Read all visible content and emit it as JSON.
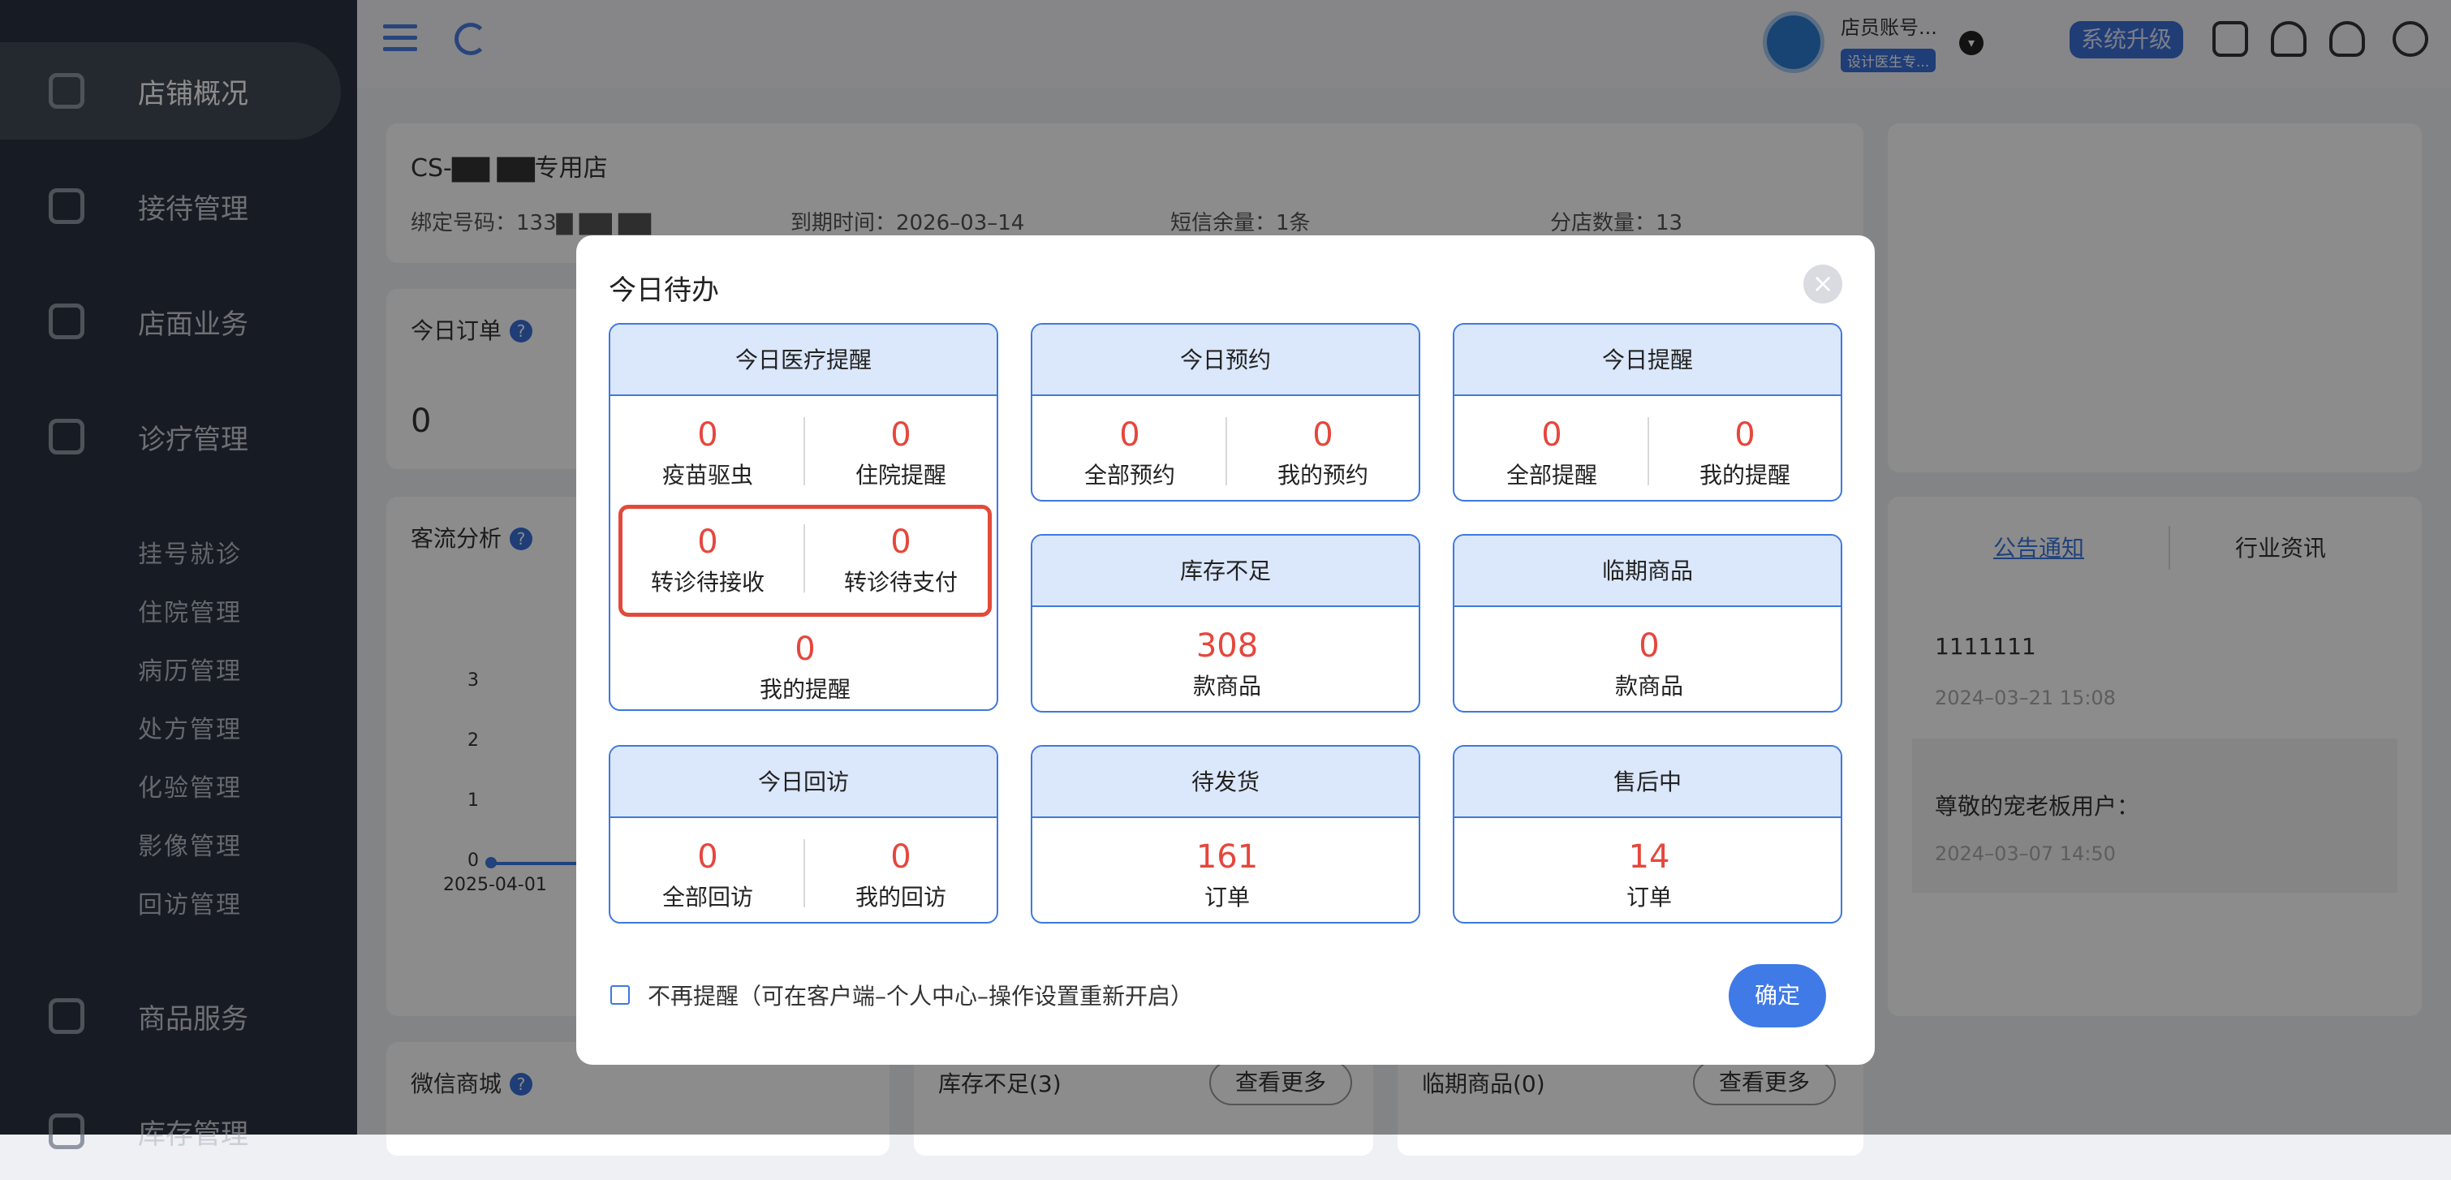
{
  "sidebar": {
    "items": [
      {
        "label": "店铺概况",
        "active": true
      },
      {
        "label": "接待管理"
      },
      {
        "label": "店面业务"
      },
      {
        "label": "诊疗管理"
      }
    ],
    "sub_items": [
      "挂号就诊",
      "住院管理",
      "病历管理",
      "处方管理",
      "化验管理",
      "影像管理",
      "回访管理"
    ],
    "bottom_items": [
      {
        "label": "商品服务"
      },
      {
        "label": "库存管理"
      }
    ]
  },
  "topbar": {
    "account_name": "店员账号...",
    "account_badge": "设计医生专...",
    "upgrade_label": "系统升级"
  },
  "store": {
    "name": "CS-▇▇ ▇▇专用店",
    "bind_number": "绑定号码：133▇ ▇▇ ▇▇",
    "expire": "到期时间：2026–03–14",
    "sms": "短信余量：1条",
    "branches": "分店数量：13"
  },
  "orders_today": {
    "title": "今日订单",
    "value": "0"
  },
  "traffic": {
    "title": "客流分析",
    "yticks": [
      "3",
      "2",
      "1",
      "0"
    ],
    "xdate": "2025-04-01"
  },
  "wechat": {
    "title": "微信商城"
  },
  "stock_low_panel": {
    "title": "库存不足(3)",
    "more": "查看更多"
  },
  "near_expiry_panel": {
    "title": "临期商品(0)",
    "more": "查看更多"
  },
  "notices": {
    "tabs": [
      "公告通知",
      "行业资讯"
    ],
    "items": [
      {
        "title": "1111111",
        "date": "2024–03–21 15:08"
      },
      {
        "title": "尊敬的宠老板用户：",
        "date": "2024–03–07 14:50"
      }
    ]
  },
  "modal": {
    "title": "今日待办",
    "close": "×",
    "boxes": {
      "medical": {
        "title": "今日医疗提醒",
        "vaccine": {
          "value": "0",
          "label": "疫苗驱虫"
        },
        "inpatient": {
          "value": "0",
          "label": "住院提醒"
        },
        "transfer_receive": {
          "value": "0",
          "label": "转诊待接收"
        },
        "transfer_pay": {
          "value": "0",
          "label": "转诊待支付"
        },
        "mine": {
          "value": "0",
          "label": "我的提醒"
        }
      },
      "appointment": {
        "title": "今日预约",
        "all": {
          "value": "0",
          "label": "全部预约"
        },
        "mine": {
          "value": "0",
          "label": "我的预约"
        }
      },
      "reminder": {
        "title": "今日提醒",
        "all": {
          "value": "0",
          "label": "全部提醒"
        },
        "mine": {
          "value": "0",
          "label": "我的提醒"
        }
      },
      "stock_low": {
        "title": "库存不足",
        "value": "308",
        "label": "款商品"
      },
      "near_expiry": {
        "title": "临期商品",
        "value": "0",
        "label": "款商品"
      },
      "revisit": {
        "title": "今日回访",
        "all": {
          "value": "0",
          "label": "全部回访"
        },
        "mine": {
          "value": "0",
          "label": "我的回访"
        }
      },
      "to_ship": {
        "title": "待发货",
        "value": "161",
        "label": "订单"
      },
      "after_sales": {
        "title": "售后中",
        "value": "14",
        "label": "订单"
      }
    },
    "dont_remind": "不再提醒（可在客户端–个人中心–操作设置重新开启）",
    "confirm": "确定"
  }
}
